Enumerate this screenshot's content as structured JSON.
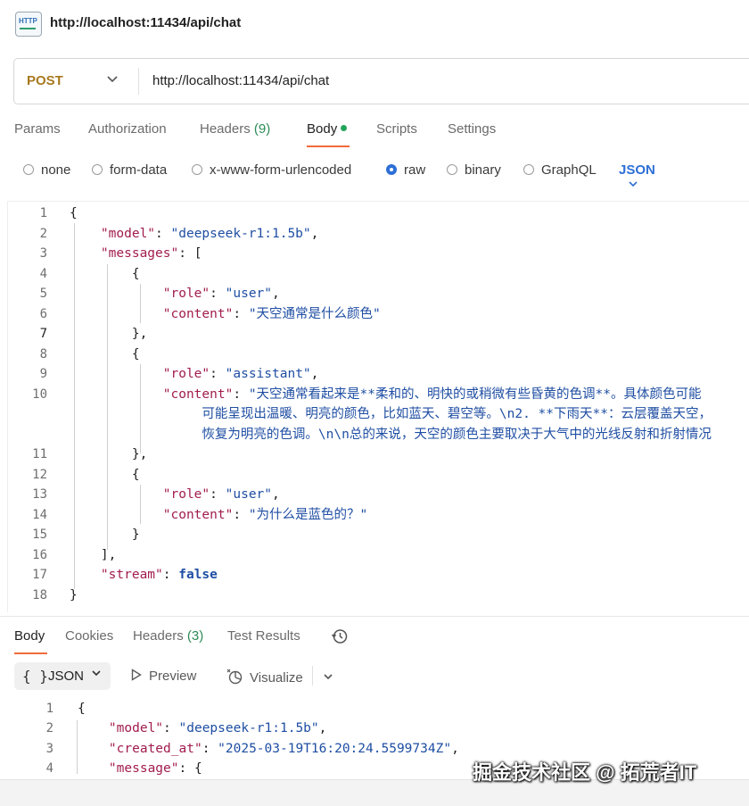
{
  "window": {
    "title": "http://localhost:11434/api/chat"
  },
  "request": {
    "method": "POST",
    "url": "http://localhost:11434/api/chat"
  },
  "request_tabs": [
    {
      "label": "Params"
    },
    {
      "label": "Authorization"
    },
    {
      "label": "Headers",
      "count": "(9)"
    },
    {
      "label": "Body",
      "active": true
    },
    {
      "label": "Scripts"
    },
    {
      "label": "Settings"
    }
  ],
  "body_types": [
    {
      "label": "none"
    },
    {
      "label": "form-data"
    },
    {
      "label": "x-www-form-urlencoded"
    },
    {
      "label": "raw",
      "selected": true
    },
    {
      "label": "binary"
    },
    {
      "label": "GraphQL"
    }
  ],
  "body_language": "JSON",
  "request_body": {
    "line_numbers": [
      "1",
      "2",
      "3",
      "4",
      "5",
      "6",
      "7",
      "8",
      "9",
      "10",
      "11",
      "12",
      "13",
      "14",
      "15",
      "16",
      "17",
      "18"
    ],
    "active_line": "7",
    "model_key": "\"model\"",
    "model_value": "\"deepseek-r1:1.5b\"",
    "messages_key": "\"messages\"",
    "role_key": "\"role\"",
    "content_key": "\"content\"",
    "msg1_role": "\"user\"",
    "msg1_content": "\"天空通常是什么颜色\"",
    "msg2_role": "\"assistant\"",
    "msg2_content_l1": "\"天空通常看起来是**柔和的、明快的或稍微有些昏黄的色调**。具体颜色可能",
    "msg2_content_l2": "可能呈现出温暖、明亮的颜色，比如蓝天、碧空等。\\n2. **下雨天**：云层覆盖天空，",
    "msg2_content_l3": "恢复为明亮的色调。\\n\\n总的来说，天空的颜色主要取决于大气中的光线反射和折射情况",
    "msg3_role": "\"user\"",
    "msg3_content": "\"为什么是蓝色的？\"",
    "stream_key": "\"stream\"",
    "stream_value": "false"
  },
  "response_tabs": [
    {
      "label": "Body",
      "active": true
    },
    {
      "label": "Cookies"
    },
    {
      "label": "Headers",
      "count": "(3)"
    },
    {
      "label": "Test Results"
    }
  ],
  "response_toolbar": {
    "format": "JSON",
    "preview": "Preview",
    "visualize": "Visualize"
  },
  "response_body": {
    "line_numbers": [
      "1",
      "2",
      "3",
      "4"
    ],
    "model_key": "\"model\"",
    "model_value": "\"deepseek-r1:1.5b\"",
    "created_key": "\"created_at\"",
    "created_value": "\"2025-03-19T16:20:24.5599734Z\"",
    "message_key": "\"message\""
  },
  "watermark": "掘金技术社区 @ 拓荒者IT",
  "colors": {
    "accent_orange": "#f26b3a",
    "method_post": "#a8791f",
    "json_key": "#a11c4d",
    "json_string": "#1f4ea3",
    "count_green": "#2e8b57",
    "radio_selected": "#2d6fd6"
  }
}
